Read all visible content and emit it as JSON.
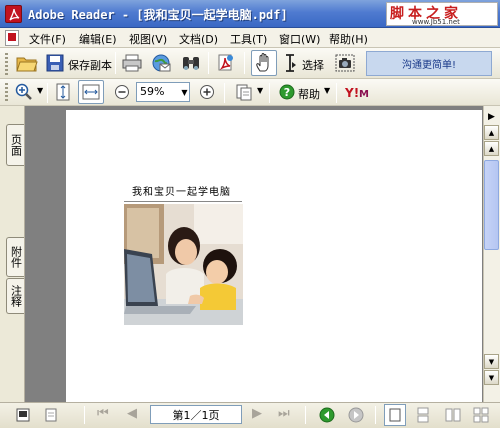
{
  "window": {
    "title": "Adobe Reader - [我和宝贝一起学电脑.pdf]",
    "watermark_text": "脚本之家",
    "watermark_url": "www.Jb51.net"
  },
  "menu": {
    "items": [
      {
        "label": "文件(F)"
      },
      {
        "label": "编辑(E)"
      },
      {
        "label": "视图(V)"
      },
      {
        "label": "文档(D)"
      },
      {
        "label": "工具(T)"
      },
      {
        "label": "窗口(W)"
      },
      {
        "label": "帮助(H)"
      }
    ]
  },
  "toolbar": {
    "save_copy_label": "保存副本",
    "select_label": "选择",
    "promo_label": "沟通更简单!",
    "zoom_value": "59%",
    "help_label": "帮助"
  },
  "side_tabs": {
    "pages": "页面",
    "attachments": "附件",
    "comments": "注释"
  },
  "document": {
    "heading": "我和宝贝一起学电脑"
  },
  "status": {
    "page_indicator": "第1／1页"
  },
  "colors": {
    "title_bar": "#4f7bd0",
    "acrobat_red": "#c1121f",
    "nav_green": "#2e9a2e",
    "watermark_red": "#c81e1e"
  }
}
